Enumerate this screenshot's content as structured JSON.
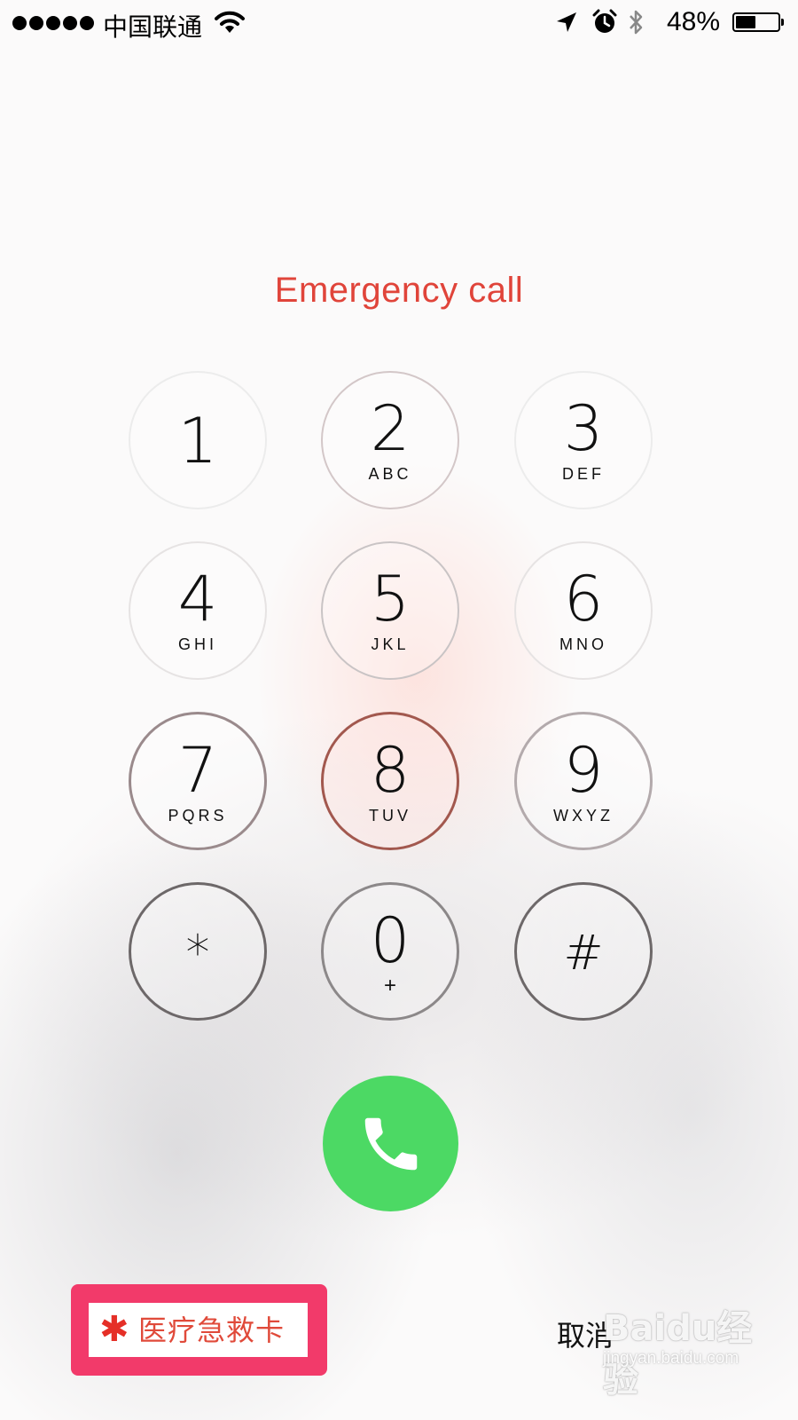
{
  "status_bar": {
    "signal_dots": 5,
    "carrier": "中国联通",
    "battery_percent_text": "48%",
    "battery_level": 0.48,
    "icons": [
      "wifi-icon",
      "location-arrow-icon",
      "alarm-clock-icon",
      "bluetooth-icon",
      "battery-icon"
    ]
  },
  "title": "Emergency call",
  "keypad": [
    {
      "digit": "1",
      "letters": ""
    },
    {
      "digit": "2",
      "letters": "ABC"
    },
    {
      "digit": "3",
      "letters": "DEF"
    },
    {
      "digit": "4",
      "letters": "GHI"
    },
    {
      "digit": "5",
      "letters": "JKL"
    },
    {
      "digit": "6",
      "letters": "MNO"
    },
    {
      "digit": "7",
      "letters": "PQRS"
    },
    {
      "digit": "8",
      "letters": "TUV"
    },
    {
      "digit": "9",
      "letters": "WXYZ"
    },
    {
      "digit": "*",
      "letters": ""
    },
    {
      "digit": "0",
      "letters": "+"
    },
    {
      "digit": "#",
      "letters": ""
    }
  ],
  "call_button": {
    "icon": "phone-icon",
    "color": "#4cd964"
  },
  "medical_id": {
    "asterisk": "✱",
    "label": "医疗急救卡",
    "highlight_color": "#f23a6a"
  },
  "cancel_label": "取消",
  "watermark": {
    "logo": "Baidu经验",
    "url": "jingyan.baidu.com"
  },
  "colors": {
    "accent_red": "#e0443a"
  }
}
